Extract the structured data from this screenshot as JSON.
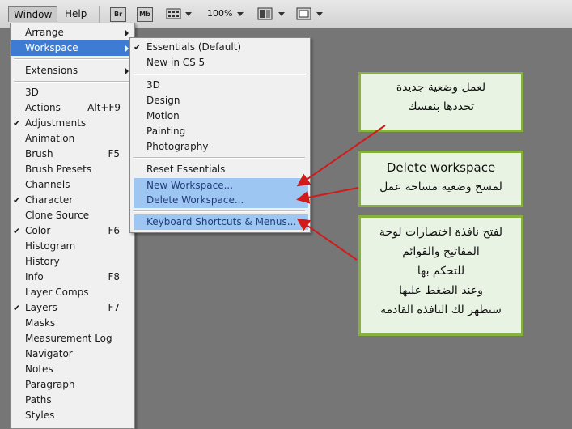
{
  "menubar": {
    "window": "Window",
    "help": "Help",
    "bridge_icon_label": "Br",
    "minibridge_icon_label": "Mb",
    "zoom": "100%"
  },
  "window_menu": {
    "items": [
      {
        "label": "Arrange",
        "submenu": true
      },
      {
        "label": "Workspace",
        "submenu": true,
        "highlighted": true
      },
      {
        "label": "Extensions",
        "submenu": true
      },
      {
        "label": "3D"
      },
      {
        "label": "Actions",
        "shortcut": "Alt+F9"
      },
      {
        "label": "Adjustments",
        "checked": true
      },
      {
        "label": "Animation"
      },
      {
        "label": "Brush",
        "shortcut": "F5"
      },
      {
        "label": "Brush Presets"
      },
      {
        "label": "Channels"
      },
      {
        "label": "Character",
        "checked": true
      },
      {
        "label": "Clone Source"
      },
      {
        "label": "Color",
        "checked": true,
        "shortcut": "F6"
      },
      {
        "label": "Histogram"
      },
      {
        "label": "History"
      },
      {
        "label": "Info",
        "shortcut": "F8"
      },
      {
        "label": "Layer Comps"
      },
      {
        "label": "Layers",
        "checked": true,
        "shortcut": "F7"
      },
      {
        "label": "Masks"
      },
      {
        "label": "Measurement Log"
      },
      {
        "label": "Navigator"
      },
      {
        "label": "Notes"
      },
      {
        "label": "Paragraph"
      },
      {
        "label": "Paths"
      },
      {
        "label": "Styles"
      }
    ]
  },
  "workspace_menu": {
    "items": [
      {
        "label": "Essentials (Default)",
        "checked": true
      },
      {
        "label": "New in CS 5"
      },
      {
        "label": "3D"
      },
      {
        "label": "Design"
      },
      {
        "label": "Motion"
      },
      {
        "label": "Painting"
      },
      {
        "label": "Photography"
      },
      {
        "label": "Reset Essentials"
      },
      {
        "label": "New Workspace...",
        "highlighted": true
      },
      {
        "label": "Delete Workspace...",
        "highlighted": true
      },
      {
        "label": "Keyboard Shortcuts & Menus...",
        "highlighted": true
      }
    ]
  },
  "callouts": {
    "new_workspace": {
      "lines": [
        "لعمل وضعية جديدة",
        "تحددها بنفسك"
      ]
    },
    "delete_workspace": {
      "lines": [
        "Delete workspace",
        "لمسح وضعية مساحة عمل"
      ]
    },
    "keyboard_shortcuts": {
      "lines": [
        "لفتح نافذة اختصارات لوحة",
        "المفاتيح والقوائم",
        "للتحكم بها",
        "وعند الضغط عليها",
        "ستظهر لك النافذة القادمة"
      ]
    }
  },
  "colors": {
    "background": "#767676",
    "menu_highlight": "#3e7bd2",
    "submenu_highlight": "#9ec6f3",
    "callout_border": "#86b13e",
    "callout_fill": "#e9f3e3",
    "arrow": "#d11a1a"
  }
}
